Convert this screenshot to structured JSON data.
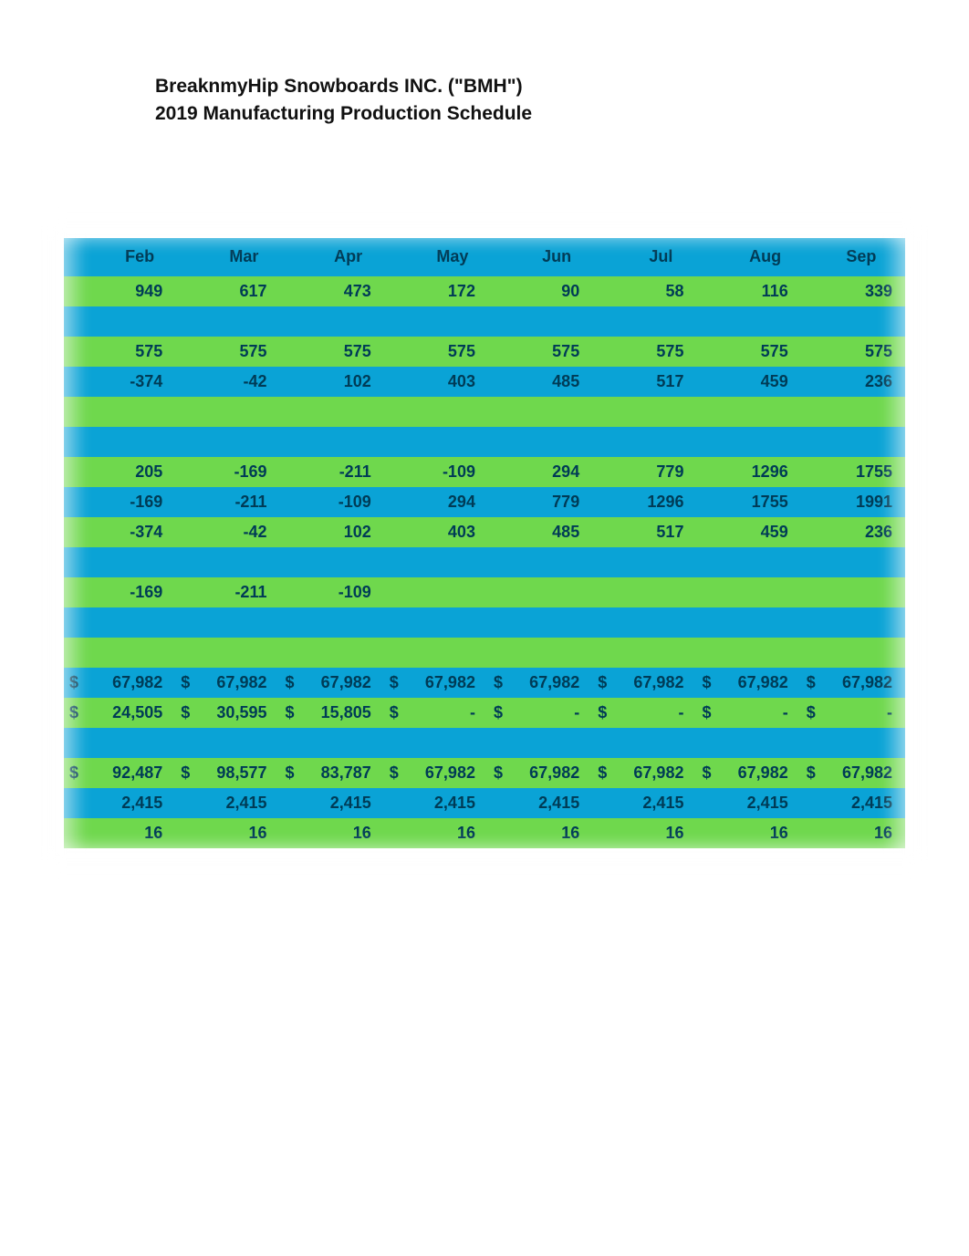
{
  "header": {
    "line1": "BreaknmyHip Snowboards INC. (\"BMH\")",
    "line2": "2019 Manufacturing Production Schedule"
  },
  "chart_data": {
    "type": "table",
    "title": "2019 Manufacturing Production Schedule",
    "columns": [
      "Feb",
      "Mar",
      "Apr",
      "May",
      "Jun",
      "Jul",
      "Aug",
      "Sep"
    ],
    "rows": [
      {
        "name": "row1",
        "values": [
          "949",
          "617",
          "473",
          "172",
          "90",
          "58",
          "116",
          "339"
        ]
      },
      {
        "name": "row2_blank"
      },
      {
        "name": "row3",
        "values": [
          "575",
          "575",
          "575",
          "575",
          "575",
          "575",
          "575",
          "575"
        ]
      },
      {
        "name": "row4",
        "values": [
          "-374",
          "-42",
          "102",
          "403",
          "485",
          "517",
          "459",
          "236"
        ]
      },
      {
        "name": "row5_blank"
      },
      {
        "name": "row6_blank"
      },
      {
        "name": "row7",
        "values": [
          "205",
          "-169",
          "-211",
          "-109",
          "294",
          "779",
          "1296",
          "1755"
        ]
      },
      {
        "name": "row8",
        "values": [
          "-169",
          "-211",
          "-109",
          "294",
          "779",
          "1296",
          "1755",
          "1991"
        ]
      },
      {
        "name": "row9",
        "values": [
          "-374",
          "-42",
          "102",
          "403",
          "485",
          "517",
          "459",
          "236"
        ]
      },
      {
        "name": "row10_blank"
      },
      {
        "name": "row11",
        "values": [
          "-169",
          "-211",
          "-109",
          "",
          "",
          "",
          "",
          ""
        ]
      },
      {
        "name": "row12_blank"
      },
      {
        "name": "row13_blank"
      },
      {
        "name": "row14_money",
        "pairs": [
          {
            "s": "$",
            "v": "67,982",
            "t": "$"
          },
          {
            "s": "",
            "v": "67,982",
            "t": "$"
          },
          {
            "s": "",
            "v": "67,982",
            "t": "$"
          },
          {
            "s": "",
            "v": "67,982",
            "t": "$"
          },
          {
            "s": "",
            "v": "67,982",
            "t": "$"
          },
          {
            "s": "",
            "v": "67,982",
            "t": "$"
          },
          {
            "s": "",
            "v": "67,982",
            "t": "$"
          },
          {
            "s": "",
            "v": "67,982",
            "t": ""
          }
        ]
      },
      {
        "name": "row15_money",
        "pairs": [
          {
            "s": "$",
            "v": "24,505",
            "t": "$"
          },
          {
            "s": "",
            "v": "30,595",
            "t": "$"
          },
          {
            "s": "",
            "v": "15,805",
            "t": "$"
          },
          {
            "s": "",
            "v": "-",
            "t": "$"
          },
          {
            "s": "",
            "v": "-",
            "t": "$"
          },
          {
            "s": "",
            "v": "-",
            "t": "$"
          },
          {
            "s": "",
            "v": "-",
            "t": "$"
          },
          {
            "s": "",
            "v": "-",
            "t": ""
          }
        ]
      },
      {
        "name": "row16_blank"
      },
      {
        "name": "row17_money",
        "pairs": [
          {
            "s": "$",
            "v": "92,487",
            "t": "$"
          },
          {
            "s": "",
            "v": "98,577",
            "t": "$"
          },
          {
            "s": "",
            "v": "83,787",
            "t": "$"
          },
          {
            "s": "",
            "v": "67,982",
            "t": "$"
          },
          {
            "s": "",
            "v": "67,982",
            "t": "$"
          },
          {
            "s": "",
            "v": "67,982",
            "t": "$"
          },
          {
            "s": "",
            "v": "67,982",
            "t": "$"
          },
          {
            "s": "",
            "v": "67,982",
            "t": ""
          }
        ]
      },
      {
        "name": "row18",
        "values": [
          "2,415",
          "2,415",
          "2,415",
          "2,415",
          "2,415",
          "2,415",
          "2,415",
          "2,415"
        ]
      },
      {
        "name": "row19",
        "values": [
          "16",
          "16",
          "16",
          "16",
          "16",
          "16",
          "16",
          "16"
        ]
      }
    ]
  }
}
